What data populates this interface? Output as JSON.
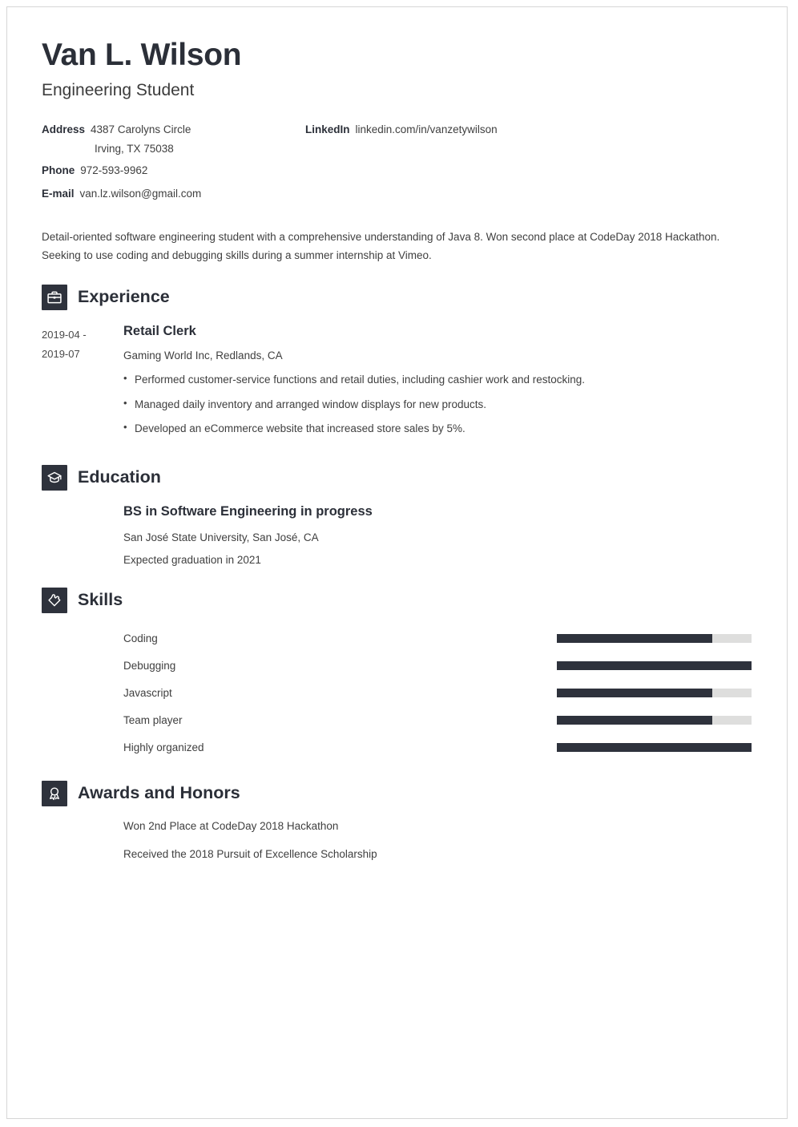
{
  "header": {
    "name": "Van L. Wilson",
    "job_title": "Engineering Student"
  },
  "contact": {
    "address_label": "Address",
    "address_line1": "4387 Carolyns Circle",
    "address_line2": "Irving, TX 75038",
    "phone_label": "Phone",
    "phone_value": "972-593-9962",
    "email_label": "E-mail",
    "email_value": "van.lz.wilson@gmail.com",
    "linkedin_label": "LinkedIn",
    "linkedin_value": "linkedin.com/in/vanzetywilson"
  },
  "summary": "Detail-oriented software engineering student with a comprehensive understanding of Java 8. Won second place at CodeDay 2018 Hackathon. Seeking to use coding and debugging skills during a summer internship at Vimeo.",
  "sections": {
    "experience": {
      "title": "Experience",
      "icon": "briefcase-icon",
      "entries": [
        {
          "dates_line1": "2019-04 -",
          "dates_line2": "2019-07",
          "role": "Retail Clerk",
          "company": "Gaming World Inc, Redlands, CA",
          "bullets": [
            "Performed customer-service functions and retail duties, including cashier work and restocking.",
            "Managed daily inventory and arranged window displays for new products.",
            "Developed an eCommerce website that increased store sales by 5%."
          ]
        }
      ]
    },
    "education": {
      "title": "Education",
      "icon": "graduation-cap-icon",
      "entries": [
        {
          "degree": "BS in Software Engineering in progress",
          "school": "San José State University, San José, CA",
          "graduation": "Expected graduation in 2021"
        }
      ]
    },
    "skills": {
      "title": "Skills",
      "icon": "puzzle-piece-icon",
      "items": [
        {
          "name": "Coding",
          "level": 80
        },
        {
          "name": "Debugging",
          "level": 100
        },
        {
          "name": "Javascript",
          "level": 80
        },
        {
          "name": "Team player",
          "level": 80
        },
        {
          "name": "Highly organized",
          "level": 100
        }
      ]
    },
    "awards": {
      "title": "Awards and Honors",
      "icon": "award-medal-icon",
      "items": [
        "Won 2nd Place at CodeDay 2018 Hackathon",
        "Received the 2018 Pursuit of Excellence Scholarship"
      ]
    }
  },
  "colors": {
    "dark": "#2e323c",
    "bar_track": "#dededd",
    "text": "#3f3f3f",
    "page_border": "#d6d6d6"
  }
}
